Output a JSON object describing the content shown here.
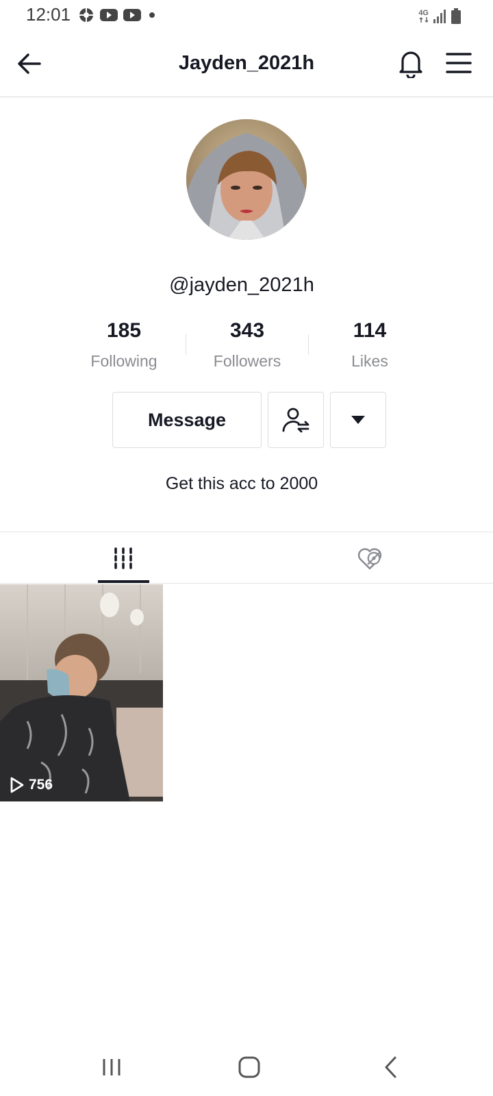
{
  "status_bar": {
    "time": "12:01",
    "network_label": "4G",
    "left_icons": [
      "data-saver-icon",
      "youtube-icon",
      "youtube-icon",
      "dot-icon"
    ],
    "right_icons": [
      "4g-icon",
      "signal-icon",
      "battery-icon"
    ]
  },
  "header": {
    "title": "Jayden_2021h",
    "icons": [
      "back-arrow-icon",
      "bell-icon",
      "hamburger-menu-icon"
    ]
  },
  "profile": {
    "handle": "@jayden_2021h",
    "bio": "Get this acc to 2000"
  },
  "stats": [
    {
      "value": "185",
      "label": "Following"
    },
    {
      "value": "343",
      "label": "Followers"
    },
    {
      "value": "114",
      "label": "Likes"
    }
  ],
  "actions": {
    "message_label": "Message",
    "icons": [
      "follow-switch-icon",
      "dropdown-triangle-icon"
    ]
  },
  "tabs": {
    "items": [
      "videos-grid-icon",
      "liked-hidden-icon"
    ],
    "active": "videos-grid-icon"
  },
  "videos": [
    {
      "views": "756"
    }
  ],
  "navbar": {
    "icons": [
      "recents-icon",
      "home-icon",
      "back-icon"
    ]
  },
  "colors": {
    "text_primary": "#161823",
    "text_secondary": "#8a8b91",
    "border": "#dcdcdc"
  }
}
